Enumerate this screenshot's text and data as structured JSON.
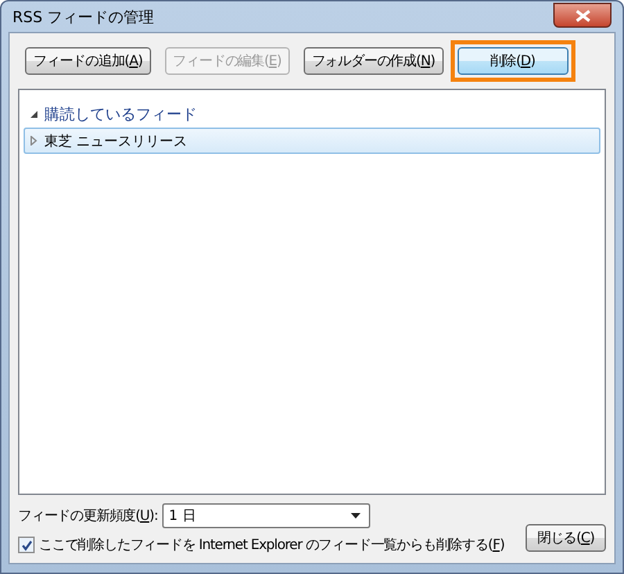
{
  "window": {
    "title": "RSS フィードの管理"
  },
  "buttons": [
    {
      "before": "フィードの追加(",
      "key": "A",
      "after": ")",
      "disabled": false,
      "highlighted": false
    },
    {
      "before": "フィードの編集(",
      "key": "E",
      "after": ")",
      "disabled": true,
      "highlighted": false
    },
    {
      "before": "フォルダーの作成(",
      "key": "N",
      "after": ")",
      "disabled": false,
      "highlighted": false
    },
    {
      "before": "削除(",
      "key": "D",
      "after": ")",
      "disabled": false,
      "highlighted": true
    }
  ],
  "tree": [
    {
      "label": "購読しているフィード",
      "expanded": true,
      "selected": false,
      "children": [
        {
          "label": "東芝  ニュースリリース",
          "expanded": false,
          "selected": true
        }
      ]
    }
  ],
  "frequency": {
    "before": "フィードの更新頻度(",
    "key": "U",
    "after": "):",
    "value": "1 日"
  },
  "checkbox": {
    "before": "ここで削除したフィードを Internet Explorer のフィード一覧からも削除する(",
    "key": "F",
    "after": ")",
    "checked": true
  },
  "close_button": {
    "before": "閉じる(",
    "key": "C",
    "after": ")"
  }
}
